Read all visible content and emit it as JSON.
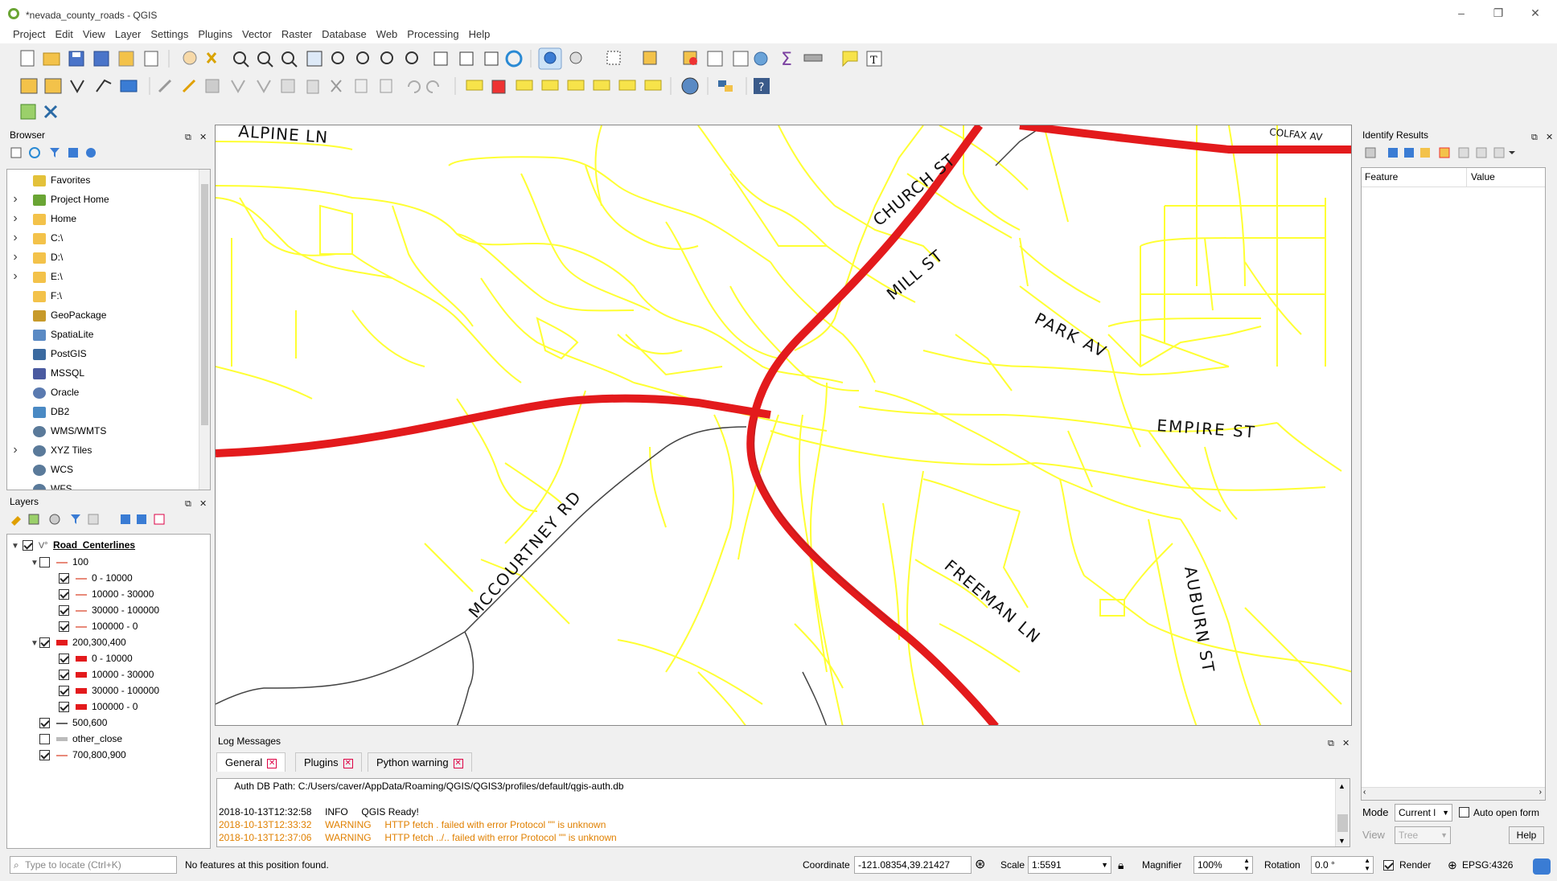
{
  "window": {
    "title": "*nevada_county_roads - QGIS",
    "min": "–",
    "max": "❐",
    "close": "✕"
  },
  "menu": [
    "Project",
    "Edit",
    "View",
    "Layer",
    "Settings",
    "Plugins",
    "Vector",
    "Raster",
    "Database",
    "Web",
    "Processing",
    "Help"
  ],
  "browser": {
    "title": "Browser",
    "items": [
      {
        "label": "Favorites",
        "expand": false,
        "icon": "star-icon"
      },
      {
        "label": "Project Home",
        "expand": true,
        "icon": "project-home-icon"
      },
      {
        "label": "Home",
        "expand": true,
        "icon": "folder-icon"
      },
      {
        "label": "C:\\",
        "expand": true,
        "icon": "folder-icon"
      },
      {
        "label": "D:\\",
        "expand": true,
        "icon": "folder-icon"
      },
      {
        "label": "E:\\",
        "expand": true,
        "icon": "folder-icon"
      },
      {
        "label": "F:\\",
        "expand": false,
        "icon": "folder-icon"
      },
      {
        "label": "GeoPackage",
        "expand": false,
        "icon": "geopackage-icon"
      },
      {
        "label": "SpatiaLite",
        "expand": false,
        "icon": "spatialite-icon"
      },
      {
        "label": "PostGIS",
        "expand": false,
        "icon": "postgis-icon"
      },
      {
        "label": "MSSQL",
        "expand": false,
        "icon": "mssql-icon"
      },
      {
        "label": "Oracle",
        "expand": false,
        "icon": "oracle-icon"
      },
      {
        "label": "DB2",
        "expand": false,
        "icon": "db2-icon"
      },
      {
        "label": "WMS/WMTS",
        "expand": false,
        "icon": "globe-icon"
      },
      {
        "label": "XYZ Tiles",
        "expand": true,
        "icon": "globe-icon"
      },
      {
        "label": "WCS",
        "expand": false,
        "icon": "globe-icon"
      },
      {
        "label": "WFS",
        "expand": false,
        "icon": "globe-icon"
      }
    ]
  },
  "layers": {
    "title": "Layers",
    "root": "Road_Centerlines",
    "rows": [
      {
        "label": "100",
        "level": 1,
        "checked": false,
        "expander": true,
        "sym": "line-thin",
        "color": "#e88a7a"
      },
      {
        "label": "0 - 10000",
        "level": 2,
        "checked": true,
        "sym": "line-thin",
        "color": "#e88a7a"
      },
      {
        "label": "10000 - 30000",
        "level": 2,
        "checked": true,
        "sym": "line-thin",
        "color": "#e88a7a"
      },
      {
        "label": "30000 - 100000",
        "level": 2,
        "checked": true,
        "sym": "line-thin",
        "color": "#e88a7a"
      },
      {
        "label": "100000 - 0",
        "level": 2,
        "checked": true,
        "sym": "line-thin",
        "color": "#e88a7a"
      },
      {
        "label": "200,300,400",
        "level": 1,
        "checked": true,
        "expander": true,
        "sym": "fill",
        "color": "#e31a1c"
      },
      {
        "label": "0 - 10000",
        "level": 2,
        "checked": true,
        "sym": "fill",
        "color": "#e31a1c"
      },
      {
        "label": "10000 - 30000",
        "level": 2,
        "checked": true,
        "sym": "fill",
        "color": "#e31a1c"
      },
      {
        "label": "30000 - 100000",
        "level": 2,
        "checked": true,
        "sym": "fill",
        "color": "#e31a1c"
      },
      {
        "label": "100000 - 0",
        "level": 2,
        "checked": true,
        "sym": "fill",
        "color": "#e31a1c"
      },
      {
        "label": "500,600",
        "level": 1,
        "checked": true,
        "sym": "line-thin",
        "color": "#666666"
      },
      {
        "label": "other_close",
        "level": 1,
        "checked": false,
        "sym": "line-gray",
        "color": "#bbbbbb"
      },
      {
        "label": "700,800,900",
        "level": 1,
        "checked": true,
        "sym": "line-thin",
        "color": "#e88a7a"
      }
    ]
  },
  "map": {
    "labels": [
      "ALPINE LN",
      "CHURCH ST",
      "MILL ST",
      "PARK AV",
      "EMPIRE ST",
      "MCCOURTNEY RD",
      "FREEMAN LN",
      "AUBURN ST",
      "COLFAX AV"
    ],
    "colors": {
      "major": "#e31a1c",
      "minor": "#ffff33",
      "other": "#555555"
    }
  },
  "identify": {
    "title": "Identify Results",
    "col_feature": "Feature",
    "col_value": "Value",
    "mode_label": "Mode",
    "mode_value": "Current l",
    "auto_open": "Auto open form",
    "view_label": "View",
    "view_value": "Tree",
    "help": "Help"
  },
  "log": {
    "title": "Log Messages",
    "tabs": [
      "General",
      "Plugins",
      "Python warning"
    ],
    "lines": [
      {
        "text": "      Auth DB Path: C:/Users/caver/AppData/Roaming/QGIS/QGIS3/profiles/default/qgis-auth.db",
        "color": "#000000"
      },
      {
        "text": "",
        "color": "#000000"
      },
      {
        "text": "2018-10-13T12:32:58     INFO     QGIS Ready!",
        "color": "#000000"
      },
      {
        "text": "2018-10-13T12:33:32     WARNING     HTTP fetch . failed with error Protocol \"\" is unknown",
        "color": "#e08000"
      },
      {
        "text": "2018-10-13T12:37:06     WARNING     HTTP fetch ../.. failed with error Protocol \"\" is unknown",
        "color": "#e08000"
      }
    ]
  },
  "status": {
    "locate_placeholder": "Type to locate (Ctrl+K)",
    "message": "No features at this position found.",
    "coordinate_label": "Coordinate",
    "coordinate": "-121.08354,39.21427",
    "scale_label": "Scale",
    "scale": "1:5591",
    "magnifier_label": "Magnifier",
    "magnifier": "100%",
    "rotation_label": "Rotation",
    "rotation": "0.0 °",
    "render_label": "Render",
    "crs": "EPSG:4326"
  }
}
